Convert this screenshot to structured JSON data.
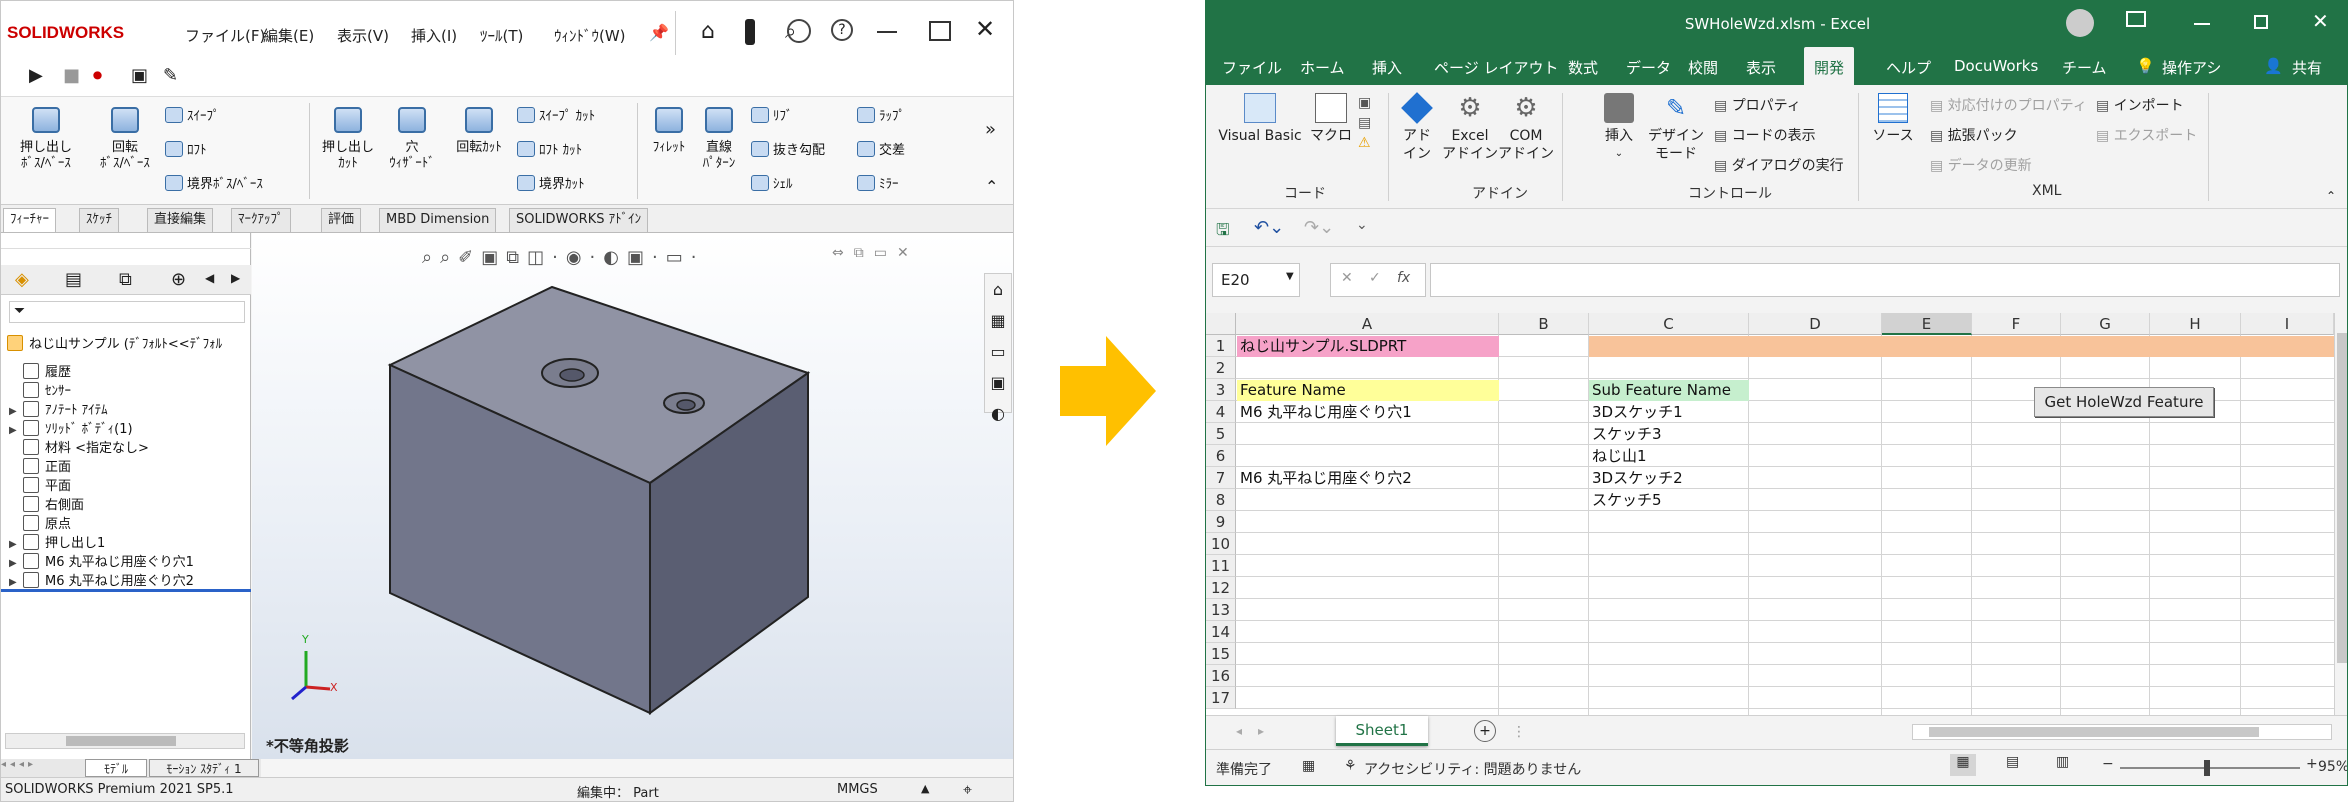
{
  "solidworks": {
    "logo": "SOLIDWORKS",
    "menu": [
      "ファイル(F)",
      "編集(E)",
      "表示(V)",
      "挿入(I)",
      "ﾂｰﾙ(T)",
      "ｳｨﾝﾄﾞｳ(W)"
    ],
    "ribbon": {
      "boss_extrude": "押し出し\nﾎﾞｽ/ﾍﾞｰｽ",
      "revolve_boss": "回転\nﾎﾞｽ/ﾍﾞｰｽ",
      "sweep": "ｽｲｰﾌﾟ",
      "loft": "ﾛﾌﾄ",
      "boundary_boss": "境界ﾎﾞｽ/ﾍﾞｰｽ",
      "extrude_cut": "押し出し\nｶｯﾄ",
      "hole_wizard": "穴\nｳｨｻﾞｰﾄﾞ",
      "revolve_cut": "回転ｶｯﾄ",
      "sweep_cut": "ｽｲｰﾌﾟ ｶｯﾄ",
      "loft_cut": "ﾛﾌﾄ ｶｯﾄ",
      "boundary_cut": "境界ｶｯﾄ",
      "fillet": "ﾌｨﾚｯﾄ",
      "linear_pattern": "直線\nﾊﾟﾀｰﾝ",
      "rib": "ﾘﾌﾞ",
      "draft": "抜き勾配",
      "shell": "ｼｪﾙ",
      "wrap": "ﾗｯﾌﾟ",
      "intersect": "交差",
      "mirror": "ﾐﾗｰ"
    },
    "tabs": [
      "ﾌｨｰﾁｬｰ",
      "ｽｹｯﾁ",
      "直接編集",
      "ﾏｰｸｱｯﾌﾟ",
      "評価",
      "MBD Dimension",
      "SOLIDWORKS ｱﾄﾞｲﾝ"
    ],
    "tree_root": "ねじ山サンプル (ﾃﾞﾌｫﾙﾄ<<ﾃﾞﾌｫﾙ",
    "tree": [
      {
        "label": "履歴",
        "arrow": ""
      },
      {
        "label": "ｾﾝｻｰ",
        "arrow": ""
      },
      {
        "label": "ｱﾉﾃｰﾄ ｱｲﾃﾑ",
        "arrow": "▶"
      },
      {
        "label": "ｿﾘｯﾄﾞ ﾎﾞﾃﾞｨ(1)",
        "arrow": "▶"
      },
      {
        "label": "材料 <指定なし>",
        "arrow": ""
      },
      {
        "label": "正面",
        "arrow": ""
      },
      {
        "label": "平面",
        "arrow": ""
      },
      {
        "label": "右側面",
        "arrow": ""
      },
      {
        "label": "原点",
        "arrow": ""
      },
      {
        "label": "押し出し1",
        "arrow": "▶"
      },
      {
        "label": "M6 丸平ねじ用座ぐり穴1",
        "arrow": "▶"
      },
      {
        "label": "M6 丸平ねじ用座ぐり穴2",
        "arrow": "▶"
      }
    ],
    "bottom_tabs": [
      "ﾓﾃﾞﾙ",
      "ﾓｰｼｮﾝ ｽﾀﾃﾞｨ 1"
    ],
    "view_label": "*不等角投影",
    "axis_y": "Y",
    "axis_x": "X",
    "status_product": "SOLIDWORKS Premium 2021 SP5.1",
    "status_mode": "編集中： Part",
    "status_units": "MMGS"
  },
  "excel": {
    "title": "SWHoleWzd.xlsm  -  Excel",
    "menu": [
      "ファイル",
      "ホーム",
      "挿入",
      "ページ レイアウト",
      "数式",
      "データ",
      "校閲",
      "表示",
      "開発",
      "ヘルプ",
      "DocuWorks",
      "チーム"
    ],
    "search_hint": "操作アシ",
    "share": "共有",
    "ribbon": {
      "visual_basic": "Visual Basic",
      "macro": "マクロ",
      "group_code": "コード",
      "addin": "アド\nイン",
      "excel_addin": "Excel\nアドイン",
      "com_addin": "COM\nアドイン",
      "group_addin": "アドイン",
      "insert": "挿入",
      "design_mode": "デザイン\nモード",
      "properties": "プロパティ",
      "view_code": "コードの表示",
      "run_dialog": "ダイアログの実行",
      "group_controls": "コントロール",
      "source": "ソース",
      "map_properties": "対応付けのプロパティ",
      "expansion_packs": "拡張パック",
      "refresh_data": "データの更新",
      "import": "インポート",
      "export": "エクスポート",
      "group_xml": "XML"
    },
    "name_box": "E20",
    "fx": "fx",
    "columns": [
      "A",
      "B",
      "C",
      "D",
      "E",
      "F",
      "G",
      "H",
      "I"
    ],
    "rows": [
      "1",
      "2",
      "3",
      "4",
      "5",
      "6",
      "7",
      "8",
      "9",
      "10",
      "11",
      "12",
      "13",
      "14",
      "15",
      "16",
      "17"
    ],
    "cells": {
      "A1": "ねじ山サンプル.SLDPRT",
      "A3": "Feature Name",
      "C3": "Sub Feature Name",
      "A4": "M6 丸平ねじ用座ぐり穴1",
      "C4": "3Dスケッチ1",
      "C5": "スケッチ3",
      "C6": "ねじ山1",
      "A7": "M6 丸平ねじ用座ぐり穴2",
      "C7": "3Dスケッチ2",
      "C8": "スケッチ5"
    },
    "button": "Get HoleWzd Feature",
    "sheet": "Sheet1",
    "status_ready": "準備完了",
    "accessibility": "アクセシビリティ: 問題ありません",
    "zoom": "95%",
    "colors": {
      "green": "#217346",
      "pink": "#f6a2c8",
      "orange": "#f8c39a",
      "yellow": "#ffff99",
      "lightgreen": "#c6efce"
    }
  }
}
